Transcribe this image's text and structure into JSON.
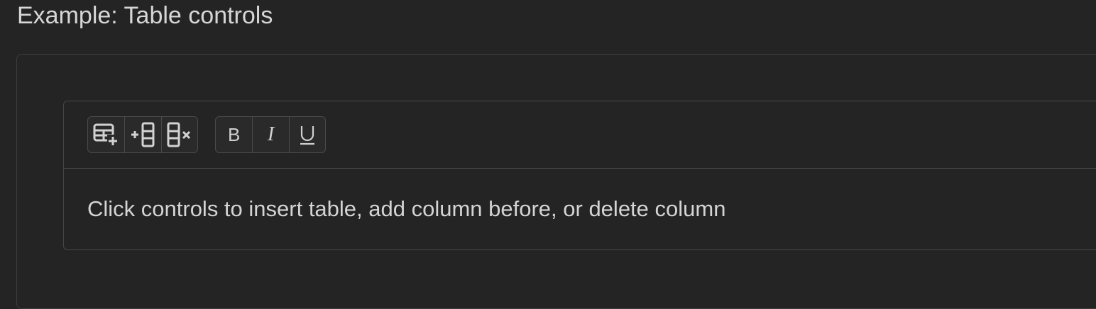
{
  "page": {
    "title": "Example: Table controls"
  },
  "toolbar": {
    "table_group": [
      {
        "name": "insert-table-button",
        "icon": "table-insert-icon"
      },
      {
        "name": "add-column-before-button",
        "icon": "column-add-before-icon"
      },
      {
        "name": "delete-column-button",
        "icon": "column-delete-icon"
      }
    ],
    "format_group": [
      {
        "name": "bold-button",
        "label": "B",
        "icon": "bold-icon"
      },
      {
        "name": "italic-button",
        "label": "I",
        "icon": "italic-icon"
      },
      {
        "name": "underline-button",
        "label": "U",
        "icon": "underline-icon"
      }
    ]
  },
  "editor": {
    "content": "Click controls to insert table, add column before, or delete column"
  },
  "colors": {
    "background": "#242424",
    "border": "#474747",
    "text": "#d4d4d4"
  }
}
